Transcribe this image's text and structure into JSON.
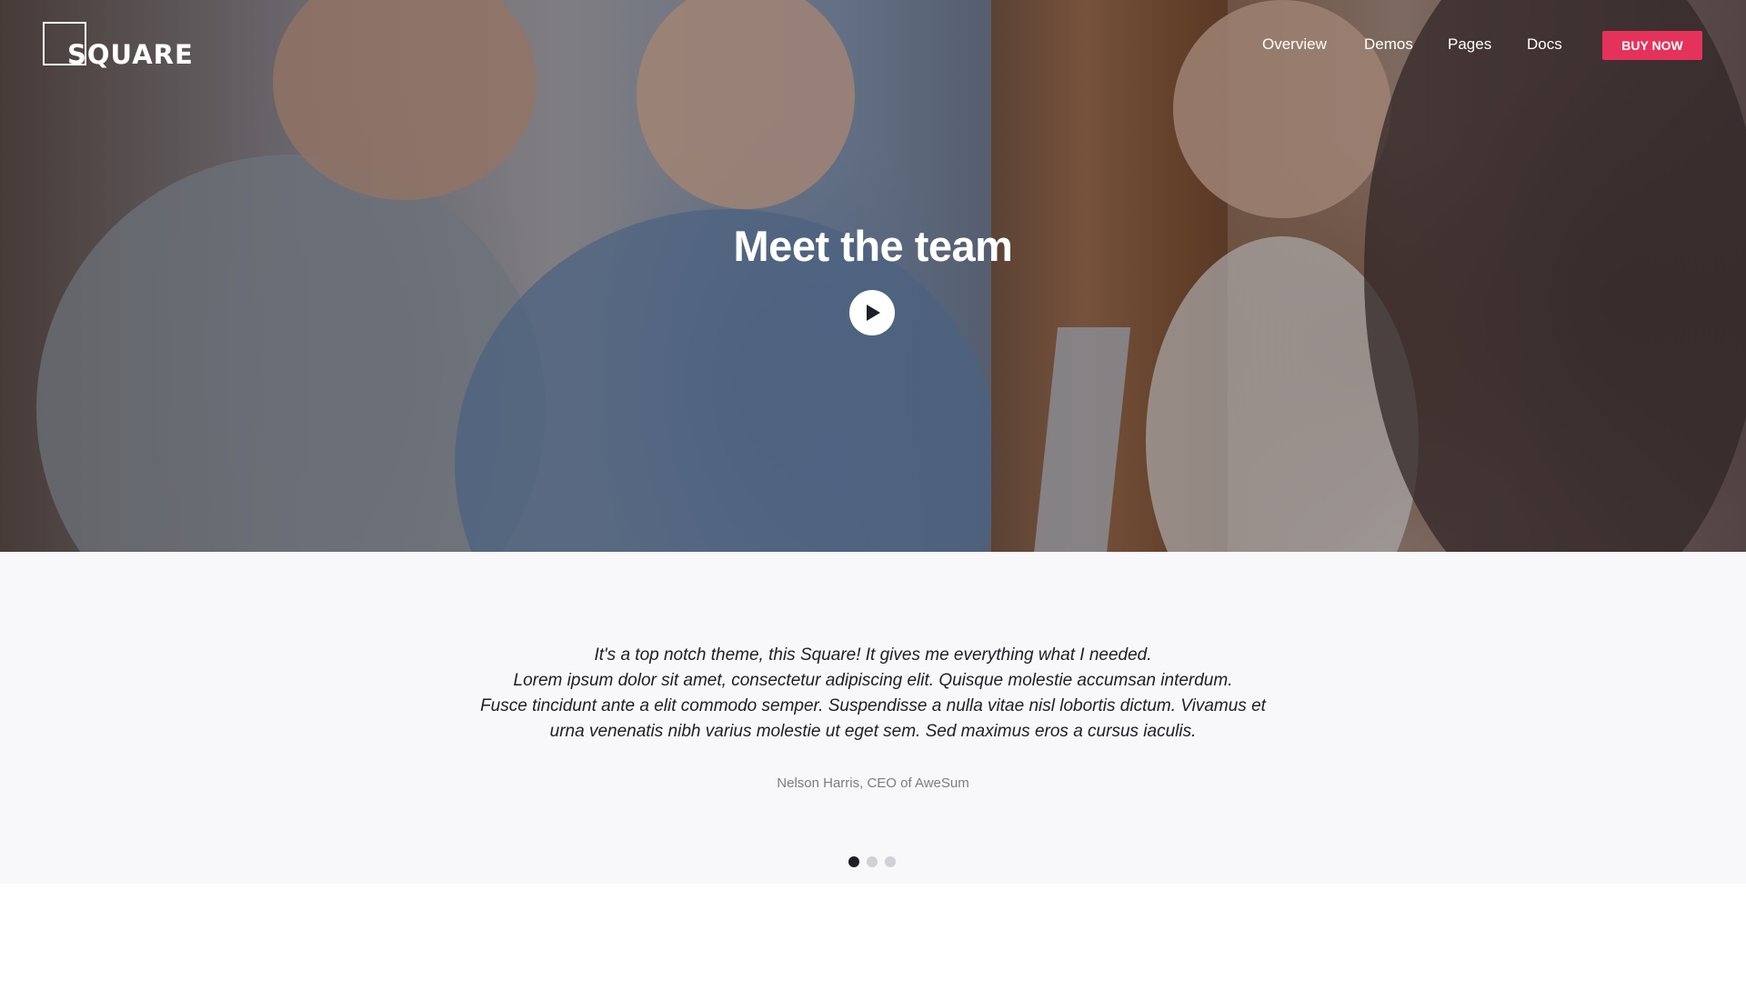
{
  "brand": {
    "logo_text": "SQUARE"
  },
  "nav": {
    "items": [
      {
        "label": "Overview"
      },
      {
        "label": "Demos"
      },
      {
        "label": "Pages"
      },
      {
        "label": "Docs"
      }
    ],
    "cta_label": "BUY NOW"
  },
  "hero": {
    "title": "Meet the team",
    "play_icon": "play-icon"
  },
  "testimonial": {
    "quote_lines": [
      "It's a top notch theme, this Square! It gives me everything what I needed.",
      "Lorem ipsum dolor sit amet, consectetur adipiscing elit. Quisque molestie accumsan interdum.",
      "Fusce tincidunt ante a elit commodo semper. Suspendisse a nulla vitae nisl lobortis dictum. Vivamus et",
      "urna venenatis nibh varius molestie ut eget sem. Sed maximus eros a cursus iaculis."
    ],
    "author": "Nelson Harris, CEO of AweSum",
    "slides": {
      "count": 3,
      "active": 1
    }
  },
  "colors": {
    "accent": "#e5325b",
    "text_dark": "#1e1e28",
    "section_bg": "#f8f7fa"
  }
}
